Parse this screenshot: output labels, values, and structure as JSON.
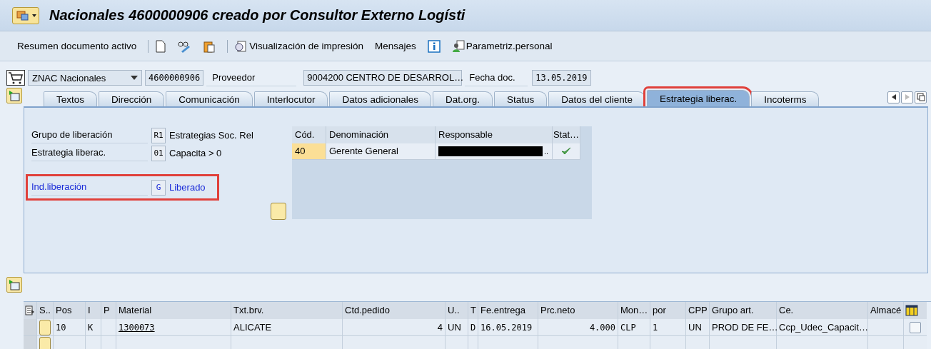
{
  "window": {
    "title": "Nacionales 4600000906 creado por Consultor Externo Logísti"
  },
  "toolbar": {
    "items": [
      {
        "kind": "text",
        "label": "Resumen documento activo"
      },
      {
        "kind": "separator"
      },
      {
        "kind": "icon"
      },
      {
        "kind": "icon"
      },
      {
        "kind": "icon"
      },
      {
        "kind": "separator"
      },
      {
        "kind": "icontext",
        "label": "Visualización de impresión"
      },
      {
        "kind": "text",
        "label": "Mensajes"
      },
      {
        "kind": "icon"
      },
      {
        "kind": "icontext",
        "label": "Parametriz.personal"
      }
    ]
  },
  "header": {
    "doc_type": "ZNAC Nacionales",
    "doc_number": "4600000906",
    "vendor_label": "Proveedor",
    "vendor": "9004200 CENTRO DE DESARROL…",
    "date_label": "Fecha doc.",
    "date": "13.05.2019"
  },
  "tabs": [
    {
      "label": "Textos",
      "selected": false,
      "highlighted": false
    },
    {
      "label": "Dirección",
      "selected": false,
      "highlighted": false
    },
    {
      "label": "Comunicación",
      "selected": false,
      "highlighted": false
    },
    {
      "label": "Interlocutor",
      "selected": false,
      "highlighted": false
    },
    {
      "label": "Datos adicionales",
      "selected": false,
      "highlighted": false
    },
    {
      "label": "Dat.org.",
      "selected": false,
      "highlighted": false
    },
    {
      "label": "Status",
      "selected": false,
      "highlighted": false
    },
    {
      "label": "Datos del cliente",
      "selected": false,
      "highlighted": false
    },
    {
      "label": "Estrategia liberac.",
      "selected": true,
      "highlighted": true
    },
    {
      "label": "Incoterms",
      "selected": false,
      "highlighted": false
    }
  ],
  "release_fields": [
    {
      "label": "Grupo de liberación",
      "code": "R1",
      "text": "Estrategias Soc. Rel",
      "link": false,
      "highlighted": false
    },
    {
      "label": "Estrategia liberac.",
      "code": "01",
      "text": "Capacita > 0",
      "link": false,
      "highlighted": false
    },
    {
      "label": "Ind.liberación",
      "code": "G",
      "text": "Liberado",
      "link": true,
      "highlighted": true
    }
  ],
  "release_table": {
    "columns": [
      "Cód.",
      "Denominación",
      "Responsable",
      "Stat…"
    ],
    "rows": [
      {
        "code": "40",
        "name": "Gerente General",
        "responsible": "..",
        "redacted": true,
        "released": true
      }
    ]
  },
  "items_table": {
    "columns": [
      "S..",
      "Pos",
      "I",
      "P",
      "Material",
      "Txt.brv.",
      "Ctd.pedido",
      "U..",
      "T",
      "Fe.entrega",
      "Prc.neto",
      "Mon…",
      "por",
      "CPP",
      "Grupo art.",
      "Ce.",
      "Almacé"
    ],
    "rows": [
      {
        "checked": false,
        "cells": [
          "",
          "10",
          "K",
          "",
          "1300073",
          "ALICATE",
          "4",
          "UN",
          "D",
          "16.05.2019",
          "4.000",
          "CLP",
          "1",
          "UN",
          "PROD DE FE…",
          "Ccp_Udec_Capacit…",
          ""
        ]
      },
      {
        "cells": [
          "",
          "",
          "",
          "",
          "",
          "",
          "",
          "",
          "",
          "",
          "",
          "",
          "",
          "",
          "",
          "",
          ""
        ]
      }
    ]
  }
}
